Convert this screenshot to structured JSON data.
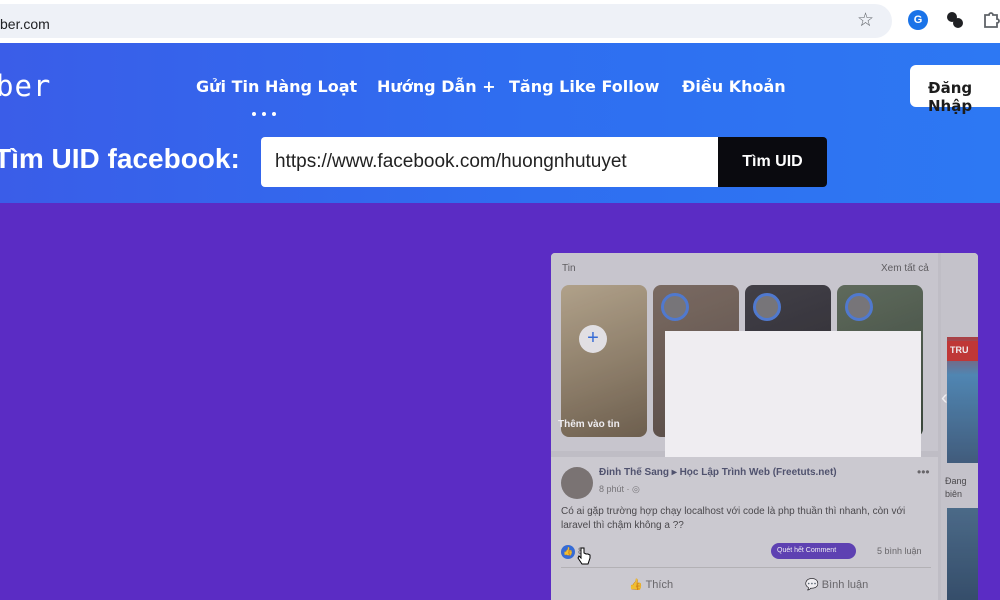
{
  "browser": {
    "url": "ber.com",
    "icons": [
      "star-icon",
      "google-lens-icon",
      "extension-icon",
      "puzzle-icon"
    ]
  },
  "header": {
    "logo": "ber",
    "nav": [
      {
        "label": "Gửi Tin Hàng Loạt"
      },
      {
        "label": "Hướng Dẫn +"
      },
      {
        "label": "Tăng Like Follow"
      },
      {
        "label": "Điều Khoản"
      }
    ],
    "login_label": "Đăng Nhập"
  },
  "finder": {
    "label": "Tìm UID facebook:",
    "input_value": "https://www.facebook.com/huongnhutuyet",
    "button_label": "Tìm UID"
  },
  "screenshot": {
    "stories_title": "Tin",
    "see_all": "Xem tất cả",
    "add_story": "Thêm vào tin",
    "post": {
      "author": "Đinh Thế Sang ▸ Học Lập Trình Web (Freetuts.net)",
      "time": "8 phút · ◎",
      "text": "Có ai gặp trường hợp chạy localhost với code là php thuần thì nhanh, còn với laravel thì chậm không a ??",
      "like_count": "8",
      "comment_pill": "Quét hết Comment",
      "comment_count": "5 bình luận",
      "action_like": "Thích",
      "action_comment": "Bình luận"
    },
    "side": {
      "badge": "TRU",
      "text": "Đang biên"
    }
  },
  "colors": {
    "header_start": "#3a5de8",
    "header_end": "#2d78f3",
    "page_bg": "#5b2cc4",
    "button_dark": "#0a0a0f"
  }
}
